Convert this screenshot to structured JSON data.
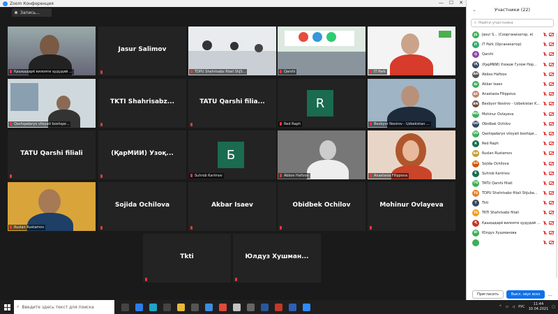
{
  "window": {
    "title": "Zoom Конференция",
    "minimize": "—",
    "maximize": "☐",
    "close": "✕"
  },
  "toolbar": {
    "record_label": "Запись..."
  },
  "tiles": [
    {
      "label": "Қашқадарё вилояти ҳудудий ...",
      "type": "photo",
      "photo": "man-dark"
    },
    {
      "label": "",
      "type": "name",
      "name": "Jasur Salimov"
    },
    {
      "label": "TDPU Shahrisabz filiali ShJS...",
      "type": "photo",
      "photo": "classroom"
    },
    {
      "label": "Qarshi",
      "type": "photo",
      "photo": "itpark-room",
      "active": true
    },
    {
      "label": "IT Park",
      "type": "photo",
      "photo": "man-red"
    },
    {
      "label": "Qashqadaryo viloyati boshqar...",
      "type": "photo",
      "photo": "office"
    },
    {
      "label": "",
      "type": "name",
      "name": "TKTI Shahrisabz..."
    },
    {
      "label": "",
      "type": "name",
      "name": "TATU Qarshi filia..."
    },
    {
      "label": "Red Raph",
      "type": "avatar",
      "letter": "R",
      "color": "#1a6b4f"
    },
    {
      "label": "Bexbyor Nosirov - Uzbekistan ...",
      "type": "photo",
      "photo": "suit"
    },
    {
      "label": "",
      "type": "name",
      "name": "TATU Qarshi filiali"
    },
    {
      "label": "",
      "type": "name",
      "name": "(ҚарМИИ) Узоқ..."
    },
    {
      "label": "Suhrob Karimov",
      "type": "avatar",
      "letter": "Б",
      "color": "#1a6b4f"
    },
    {
      "label": "Abbos Hafizov",
      "type": "photo",
      "photo": "bw-man"
    },
    {
      "label": "Anastasia Filippova",
      "type": "photo",
      "photo": "woman"
    },
    {
      "label": "Ruslan Rustamov",
      "type": "photo",
      "photo": "yellow-man"
    },
    {
      "label": "",
      "type": "name",
      "name": "Sojida Ochilova"
    },
    {
      "label": "",
      "type": "name",
      "name": "Akbar Isaev"
    },
    {
      "label": "",
      "type": "name",
      "name": "Obidbek Ochilov"
    },
    {
      "label": "",
      "type": "name",
      "name": "Mohinur Ovlayeva"
    },
    {
      "label": "",
      "type": "name",
      "name": "Tkti"
    },
    {
      "label": "",
      "type": "name",
      "name": "Юлдуз Хушман..."
    }
  ],
  "panel": {
    "title": "Участники (22)",
    "search_placeholder": "Найти участника",
    "participants": [
      {
        "initials": "JS",
        "name": "Jasur S... (Соорганизатор, я)",
        "color": "#3fae5a"
      },
      {
        "initials": "IT",
        "name": "IT Park (Организатор)",
        "color": "#2eaa6b"
      },
      {
        "initials": "Q",
        "name": "Qarshi",
        "color": "#8e44ad"
      },
      {
        "initials": "(Қ",
        "name": "(ҚарМИИ) Узоқов Гулом Нор...",
        "color": "#34495e"
      },
      {
        "initials": "AH",
        "name": "Abbos Hafizov",
        "color": "#555555"
      },
      {
        "initials": "AI",
        "name": "Akbar Isaev",
        "color": "#3fae5a"
      },
      {
        "initials": "AF",
        "name": "Anastasia Filippova",
        "color": "#c0866a"
      },
      {
        "initials": "BN",
        "name": "Bexbyor Nosirov - Uzbekistan K...",
        "color": "#6d4c3b"
      },
      {
        "initials": "MO",
        "name": "Mohinur Ovlayeva",
        "color": "#3fae5a"
      },
      {
        "initials": "OO",
        "name": "Obidbek Ochilov",
        "color": "#34495e"
      },
      {
        "initials": "QV",
        "name": "Qashqadaryo viloyati boshqar...",
        "color": "#3fae5a"
      },
      {
        "initials": "R",
        "name": "Red Raph",
        "color": "#1a6b4f"
      },
      {
        "initials": "RR",
        "name": "Ruslan Rustamov",
        "color": "#c49a2c"
      },
      {
        "initials": "SO",
        "name": "Sojida Ochilova",
        "color": "#d35400"
      },
      {
        "initials": "Б",
        "name": "Suhrob Karimov",
        "color": "#1a6b4f"
      },
      {
        "initials": "TQ",
        "name": "TATU Qarshi filiali",
        "color": "#3fae5a"
      },
      {
        "initials": "TS",
        "name": "TDPU Shahrisabz filiali ShJuba...",
        "color": "#e67e22"
      },
      {
        "initials": "T",
        "name": "Tkti",
        "color": "#34495e"
      },
      {
        "initials": "TS",
        "name": "TKTI Shahrisabz filiali",
        "color": "#f39c12"
      },
      {
        "initials": "Қ",
        "name": "Қашқадарё вилояти ҳудудий б...",
        "color": "#c0392b"
      },
      {
        "initials": "Ю",
        "name": "Юлдуз Хушманова",
        "color": "#3fae5a"
      },
      {
        "initials": "",
        "name": "",
        "color": "#3fae5a"
      }
    ],
    "invite_label": "Пригласить",
    "mute_all_label": "Выкл. звук всех",
    "more_label": "..."
  },
  "taskbar": {
    "search_placeholder": "Введите здесь текст для поиска",
    "lang": "РУС",
    "time": "11:44",
    "date": "10.04.2021"
  }
}
